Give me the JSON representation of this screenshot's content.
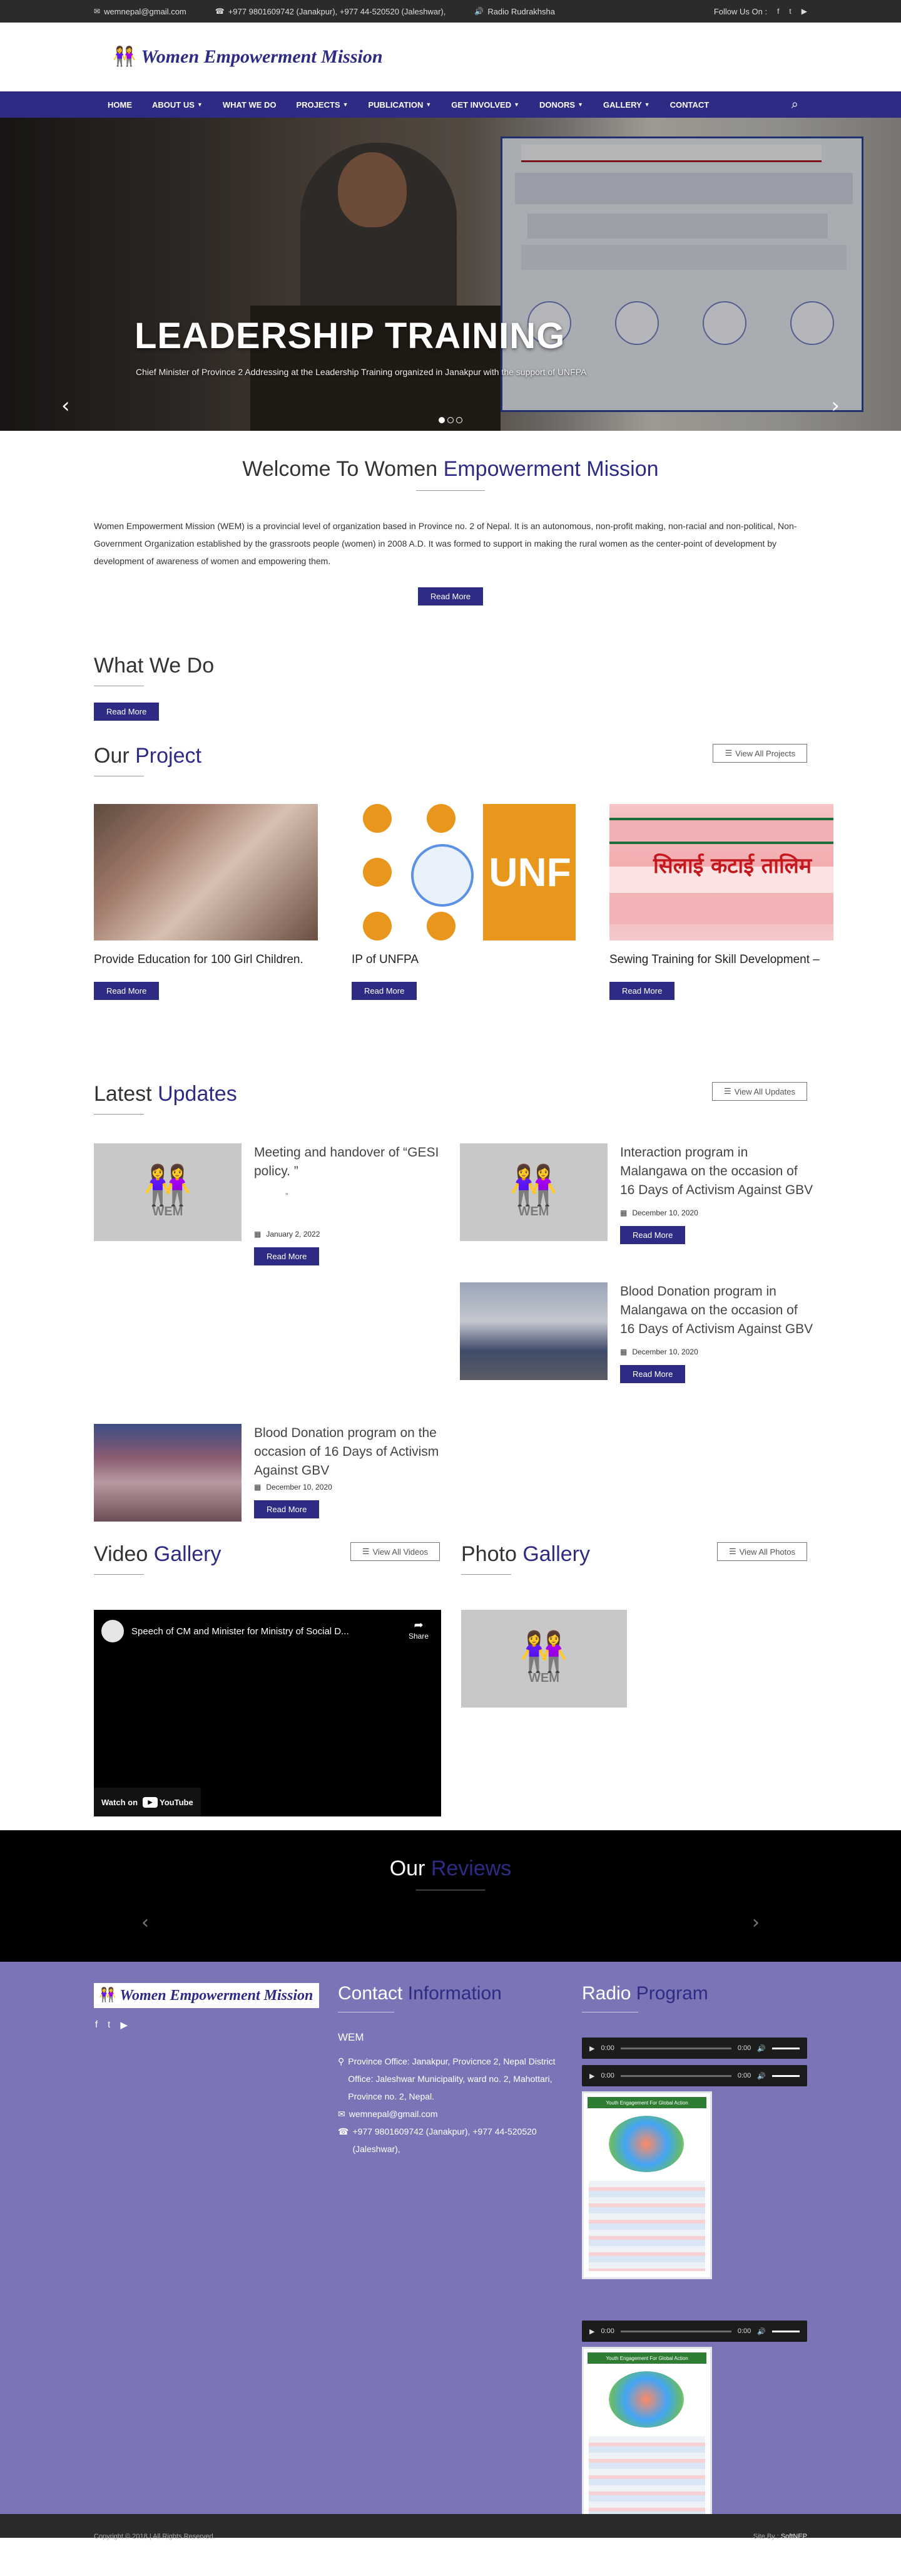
{
  "topbar": {
    "email": "wemnepal@gmail.com",
    "phone": "+977 9801609742 (Janakpur), +977 44-520520 (Jaleshwar),",
    "radio": "Radio Rudrakhsha",
    "follow": "Follow Us On :"
  },
  "brand": {
    "name": "Women Empowerment Mission"
  },
  "nav": [
    {
      "label": "HOME",
      "dropdown": false
    },
    {
      "label": "ABOUT US",
      "dropdown": true
    },
    {
      "label": "WHAT WE DO",
      "dropdown": false
    },
    {
      "label": "PROJECTS",
      "dropdown": true
    },
    {
      "label": "PUBLICATION",
      "dropdown": true
    },
    {
      "label": "GET INVOLVED",
      "dropdown": true
    },
    {
      "label": "DONORS",
      "dropdown": true
    },
    {
      "label": "GALLERY",
      "dropdown": true
    },
    {
      "label": "CONTACT",
      "dropdown": false
    }
  ],
  "slider": {
    "title": "LEADERSHIP TRAINING",
    "subtitle": "Chief Minister of Province 2 Addressing at the Leadership Training organized in Janakpur with the support of UNFPA",
    "slides": 3,
    "active": 1
  },
  "welcome": {
    "title_plain": "Welcome To Women ",
    "title_hl": "Empowerment Mission",
    "text": "Women Empowerment Mission (WEM) is a provincial level of organization based in Province no. 2 of Nepal. It is an autonomous, non-profit making, non-racial and non-political, Non-Government Organization established by the grassroots people (women) in 2008 A.D. It was formed to support in making the rural women as the center-point of development by development of awareness of women and empowering them.",
    "button": "Read More"
  },
  "whatwedo": {
    "title": "What We Do",
    "button": "Read More"
  },
  "projects": {
    "title_plain": "Our ",
    "title_hl": "Project",
    "view_all": "View All Projects",
    "items": [
      {
        "title": "Provide Education for 100 Girl Children.",
        "button": "Read More"
      },
      {
        "title": "IP of UNFPA",
        "button": "Read More"
      },
      {
        "title": "Sewing Training for Skill Development –",
        "button": "Read More"
      }
    ],
    "img2_text": "UNF",
    "img3_text": "सिलाई कटाई तालिम"
  },
  "updates": {
    "title_plain": "Latest ",
    "title_hl": "Updates",
    "view_all": "View All Updates",
    "items": [
      {
        "title": "Meeting and handover of “GESI policy. ”",
        "quote": "”",
        "date": "January 2, 2022",
        "button": "Read More"
      },
      {
        "title": "Interaction program in Malangawa on the occasion of 16 Days of Activism Against GBV",
        "date": "December 10, 2020",
        "button": "Read More"
      },
      {
        "title": "Blood Donation program in Malangawa on the occasion of 16 Days of Activism Against GBV",
        "date": "December 10, 2020",
        "button": "Read More"
      },
      {
        "title": "Blood Donation program on the occasion of 16 Days of Activism Against GBV",
        "date": "December 10, 2020",
        "button": "Read More"
      }
    ],
    "wem_label": "WEM"
  },
  "video_gallery": {
    "title_plain": "Video ",
    "title_hl": "Gallery",
    "view_all": "View All Videos",
    "video_title": "Speech of CM and Minister for Ministry of Social D...",
    "share": "Share",
    "watch_on": "Watch on",
    "youtube": "YouTube"
  },
  "photo_gallery": {
    "title_plain": "Photo ",
    "title_hl": "Gallery",
    "view_all": "View All Photos"
  },
  "reviews": {
    "title_plain": "Our ",
    "title_hl": "Reviews"
  },
  "footer": {
    "contact_plain": "Contact ",
    "contact_hl": "Information",
    "org": "WEM",
    "address": "Province Office: Janakpur, Provicnce 2, Nepal District Office: Jaleshwar Municipality, ward no. 2, Mahottari, Province no. 2, Nepal.",
    "email": "wemnepal@gmail.com",
    "phone": "+977 9801609742 (Janakpur), +977 44-520520 (Jaleshwar),",
    "radio_plain": "Radio ",
    "radio_hl": "Program",
    "audio_time_1": "0:00",
    "audio_time_2": "0:00",
    "poster_heading": "Youth Engagement For Global Action"
  },
  "copyright": {
    "text": "Copyright © 2018 | All Rights Reserved.",
    "site_by": "Site By : ",
    "brand": "SoftNEP"
  },
  "colors": {
    "brand": "#2e2b84",
    "footer_bg": "#7b75b8",
    "topbar_bg": "#2b2b2b"
  }
}
